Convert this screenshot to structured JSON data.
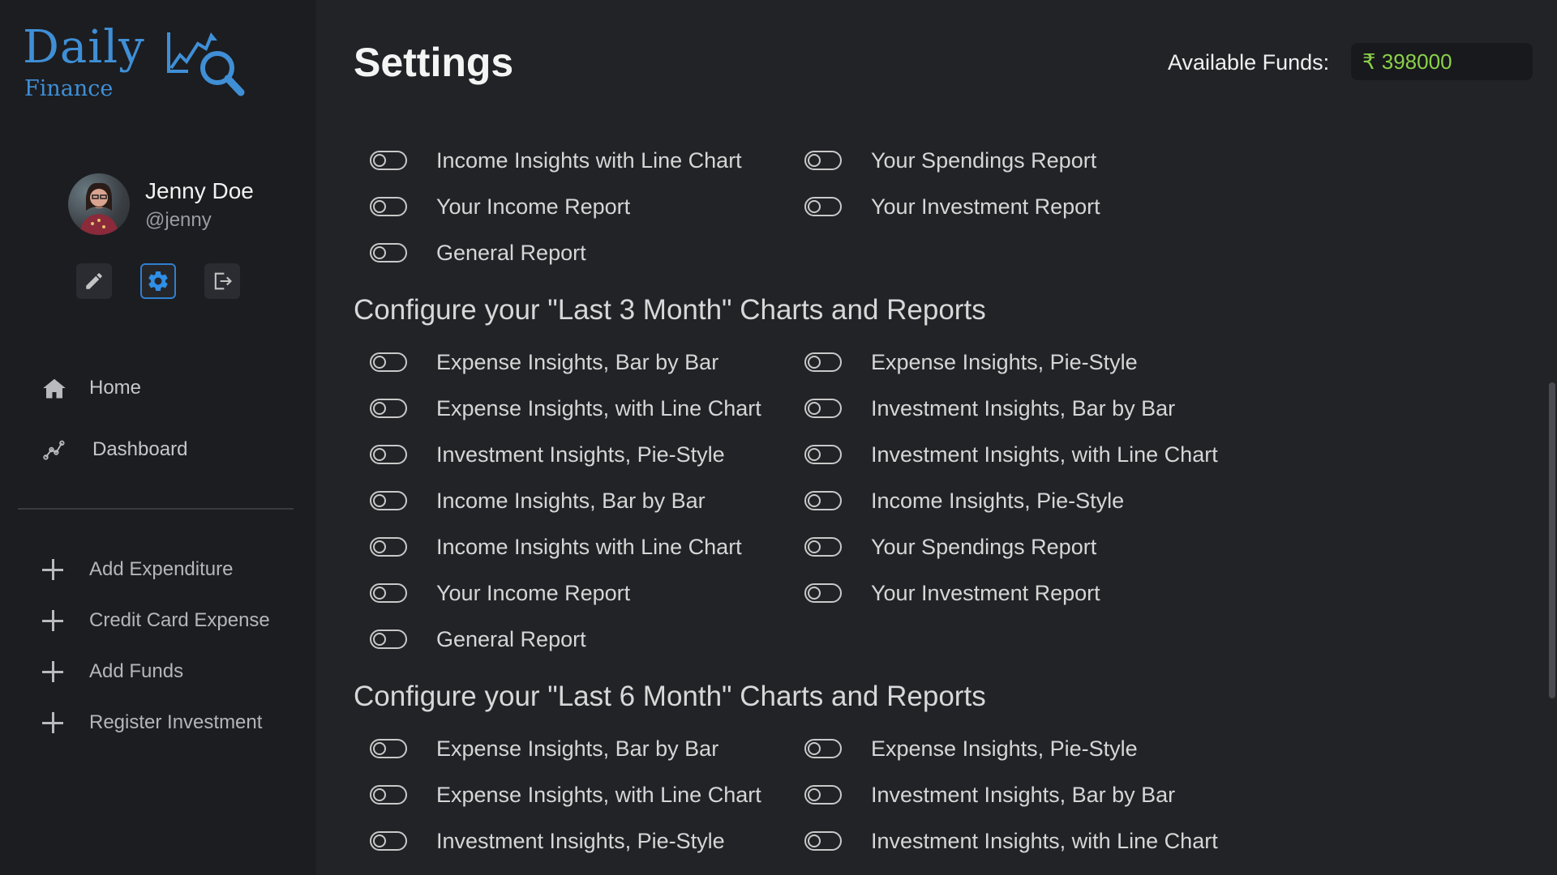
{
  "app": {
    "logo_main": "Daily",
    "logo_sub": "Finance"
  },
  "user": {
    "name": "Jenny Doe",
    "handle": "@jenny"
  },
  "nav": {
    "home": "Home",
    "dashboard": "Dashboard"
  },
  "actions": {
    "add_expenditure": "Add Expenditure",
    "credit_card_expense": "Credit Card Expense",
    "add_funds": "Add Funds",
    "register_investment": "Register Investment"
  },
  "header": {
    "title": "Settings",
    "funds_label": "Available Funds:",
    "funds_value": "₹ 398000"
  },
  "sections": {
    "top": {
      "col1": [
        "Income Insights with Line Chart",
        "Your Income Report",
        "General Report"
      ],
      "col2": [
        "Your Spendings Report",
        "Your Investment Report"
      ]
    },
    "last3": {
      "title": "Configure your \"Last 3 Month\" Charts and Reports",
      "col1": [
        "Expense Insights, Bar by Bar",
        "Expense Insights, with Line Chart",
        "Investment Insights, Pie-Style",
        "Income Insights, Bar by Bar",
        "Income Insights with Line Chart",
        "Your Income Report",
        "General Report"
      ],
      "col2": [
        "Expense Insights, Pie-Style",
        "Investment Insights, Bar by Bar",
        "Investment Insights, with Line Chart",
        "Income Insights, Pie-Style",
        "Your Spendings Report",
        "Your Investment Report"
      ]
    },
    "last6": {
      "title": "Configure your \"Last 6 Month\" Charts and Reports",
      "col1": [
        "Expense Insights, Bar by Bar",
        "Expense Insights, with Line Chart",
        "Investment Insights, Pie-Style"
      ],
      "col2": [
        "Expense Insights, Pie-Style",
        "Investment Insights, Bar by Bar",
        "Investment Insights, with Line Chart"
      ]
    }
  },
  "colors": {
    "accent": "#3f8fd6",
    "funds_green": "#8ad14a"
  }
}
